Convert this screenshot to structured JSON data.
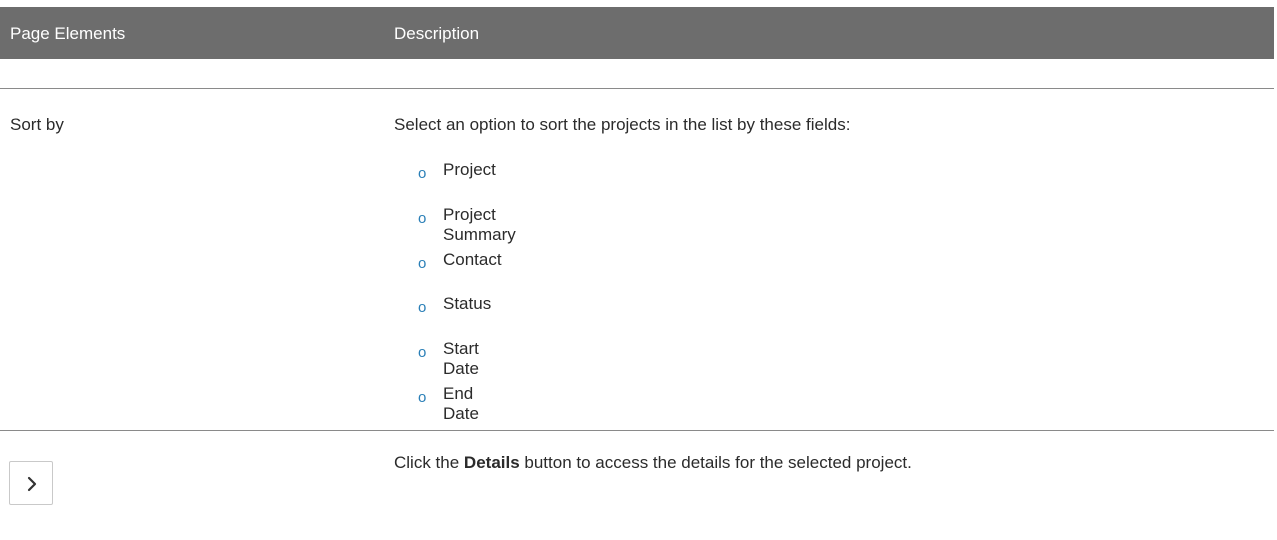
{
  "table": {
    "headers": {
      "page_elements": "Page Elements",
      "description": "Description"
    },
    "sort_row": {
      "label": "Sort by",
      "intro": "Select an option to sort the projects in the list by these fields:",
      "options": [
        "Project",
        "Project Summary",
        "Contact",
        "Status",
        "Start Date",
        "End Date"
      ],
      "bullet": "o"
    },
    "details_row": {
      "icon": "chevron-right-icon",
      "desc_before": "Click the ",
      "desc_bold": "Details",
      "desc_after": " button to access the details for the selected project."
    }
  },
  "colors": {
    "header_bg": "#6d6d6d",
    "bullet": "#2a7fb7",
    "rule": "#8a8a8a"
  }
}
